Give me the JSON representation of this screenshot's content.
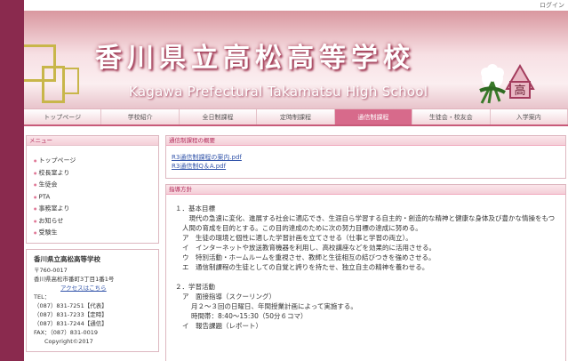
{
  "topbar": {
    "login": "ログイン"
  },
  "header": {
    "title_jp": "香川県立高松高等学校",
    "title_en": "Kagawa Prefectural Takamatsu High School",
    "emblem_char": "高"
  },
  "nav": [
    {
      "label": "トップページ",
      "active": false
    },
    {
      "label": "学校紹介",
      "active": false
    },
    {
      "label": "全日制課程",
      "active": false
    },
    {
      "label": "定時制課程",
      "active": false
    },
    {
      "label": "通信制課程",
      "active": true
    },
    {
      "label": "生徒会・校友会",
      "active": false
    },
    {
      "label": "入学案内",
      "active": false
    }
  ],
  "sidebar": {
    "menu_title": "メニュー",
    "menu": [
      "トップページ",
      "校長室より",
      "生徒会",
      "PTA",
      "事務室より",
      "お知らせ",
      "受験生"
    ],
    "info": {
      "school": "香川県立高松高等学校",
      "postal": "〒760-0017",
      "address": "香川県高松市番町3丁目1番1号",
      "access": "アクセスはこちら",
      "tel_label": "TEL：",
      "tel1": "（087）831-7251【代表】",
      "tel2": "（087）831-7233【定時】",
      "tel3": "（087）831-7244【通信】",
      "fax": "FAX：（087）831-0019",
      "copyright": "Copyright©2017"
    }
  },
  "main": {
    "box1_title": "通信制課程の概要",
    "links": [
      "R3通信制課程の案内.pdf",
      "R3通信制Q＆A.pdf"
    ],
    "box2_title": "指導方針",
    "content": {
      "h1": "１．基本目標",
      "p1": "　現代の急速に変化、進展する社会に適応でき、生涯自ら学習する自主的・創造的な精神と健康な身体及び豊かな情操をもつ人間の育成を目的とする。この目的達成のために次の努力目標の達成に努める。",
      "a": "ア　生徒の環境と個性に適した学習計画を立てさせる（仕事と学習の両立）。",
      "i": "イ　インターネットや放送教育機器を利用し、高校講座などを効果的に活用させる。",
      "u": "ウ　特別活動・ホームルームを重視させ、教師と生徒相互の結びつきを強めさせる。",
      "e": "エ　通信制課程の生徒としての自覚と誇りを持たせ、独立自主の精神を養わせる。",
      "h2": "２．学習活動",
      "s1": "ア　面接指導（スクーリング）",
      "s1a": "月２～３回の日曜日、年間授業計画によって実施する。",
      "s1b": "時間帯：8:40～15:30（50分６コマ）",
      "s2": "イ　報告課題（レポート）"
    }
  }
}
